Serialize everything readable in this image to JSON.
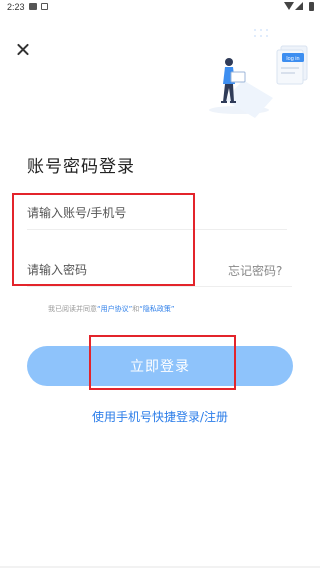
{
  "status_bar": {
    "time": "2:23",
    "icons": [
      "notification-icon",
      "app-icon",
      "wifi-icon",
      "signal-icon",
      "battery-icon"
    ]
  },
  "illustration": {
    "badge_text": "log in"
  },
  "title": "账号密码登录",
  "account_input": {
    "value": "",
    "placeholder": "请输入账号/手机号"
  },
  "password_input": {
    "value": "",
    "placeholder": "请输入密码"
  },
  "forgot_password": "忘记密码?",
  "agreement": {
    "prefix": "我已阅读并同意",
    "user_agreement": "“用户协议”",
    "and": "和",
    "privacy_policy": "“隐私政策”"
  },
  "login_button": "立即登录",
  "quick_login": "使用手机号快捷登录/注册",
  "colors": {
    "accent": "#2b7de9",
    "button": "#8ec3fb",
    "annotation": "#e3242b"
  }
}
